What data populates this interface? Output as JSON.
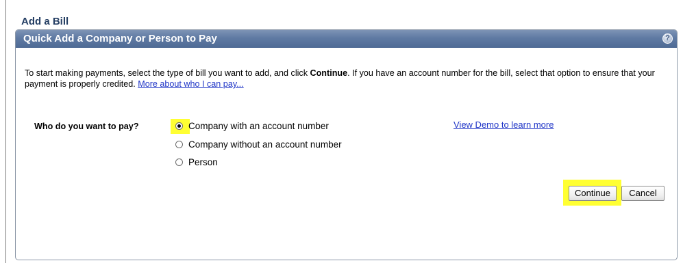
{
  "page": {
    "title": "Add a Bill"
  },
  "panel": {
    "title": "Quick Add a Company or Person to Pay",
    "help_icon": "?"
  },
  "intro": {
    "text_before_bold": "To start making payments, select the type of bill you want to add, and click ",
    "bold_word": "Continue",
    "text_after_bold": ". If you have an account number for the bill, select that option to ensure that your payment is properly credited. ",
    "link_text": "More about who I can pay..."
  },
  "form": {
    "question_label": "Who do you want to pay?",
    "options": [
      {
        "label": "Company with an account number",
        "selected": true
      },
      {
        "label": "Company without an account number",
        "selected": false
      },
      {
        "label": "Person",
        "selected": false
      }
    ],
    "demo_link": "View Demo to learn more"
  },
  "buttons": {
    "continue_label": "Continue",
    "cancel_label": "Cancel"
  },
  "colors": {
    "header_bar": "#5f7aa3",
    "title_text": "#243e63",
    "link": "#1f35c7",
    "highlight": "#ffff33"
  }
}
